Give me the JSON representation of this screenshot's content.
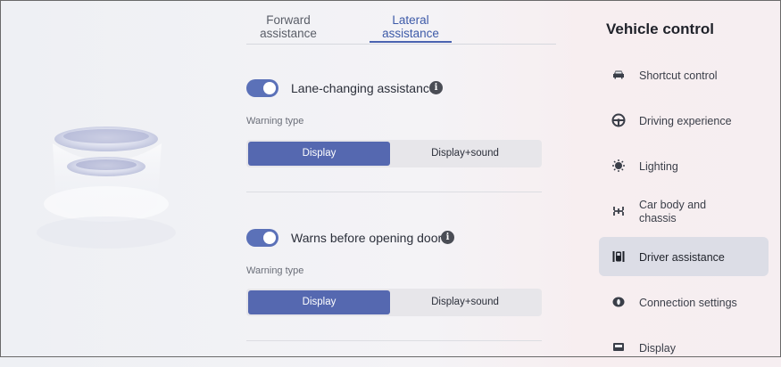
{
  "tabs": [
    {
      "label_line1": "Forward",
      "label_line2": "assistance",
      "active": false
    },
    {
      "label_line1": "Lateral",
      "label_line2": "assistance",
      "active": true
    }
  ],
  "settings": [
    {
      "label": "Lane-changing assistance",
      "enabled": true,
      "info_icon": "info-icon",
      "warning_type_label": "Warning type",
      "options": [
        "Display",
        "Display+sound"
      ],
      "selected": "Display"
    },
    {
      "label": "Warns before opening doors",
      "enabled": true,
      "info_icon": "info-icon",
      "warning_type_label": "Warning type",
      "options": [
        "Display",
        "Display+sound"
      ],
      "selected": "Display"
    }
  ],
  "sidebar": {
    "title": "Vehicle control",
    "items": [
      {
        "label": "Shortcut control",
        "icon": "car-icon"
      },
      {
        "label": "Driving experience",
        "icon": "steering-wheel-icon"
      },
      {
        "label": "Lighting",
        "icon": "light-icon"
      },
      {
        "label_line1": "Car body and",
        "label_line2": "chassis",
        "icon": "chassis-icon"
      },
      {
        "label": "Driver assistance",
        "icon": "driver-assistance-icon",
        "active": true
      },
      {
        "label": "Connection settings",
        "icon": "connection-icon"
      },
      {
        "label": "Display",
        "icon": "display-icon"
      }
    ]
  },
  "colors": {
    "accent": "#5568b0",
    "toggle": "#5b71b8",
    "active_nav": "#dcdde6"
  }
}
